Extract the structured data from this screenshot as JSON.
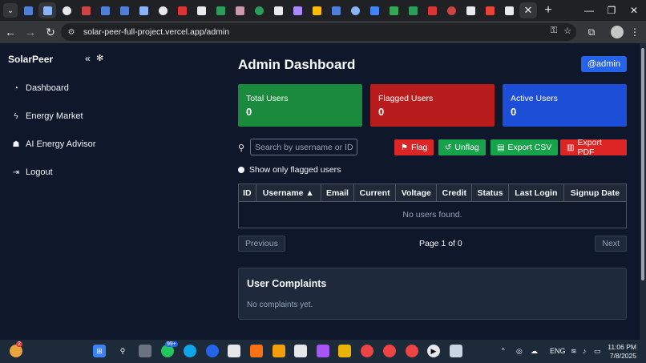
{
  "browser": {
    "url": "solar-peer-full-project.vercel.app/admin",
    "tab_favicon_colors": [
      "#4f7fd9",
      "#8ab4f8",
      "#e8eaed",
      "#c44",
      "#4f7fd9",
      "#4f7fd9",
      "#8ab4f8",
      "#e8eaed",
      "#d33",
      "#e8eaed",
      "#2a9d5a",
      "#c9a",
      "#2a9d5a",
      "#e8eaed",
      "#a8f",
      "#fbbc04",
      "#4f7fd9",
      "#8ab4f8",
      "#4285f4",
      "#34a853",
      "#2a9d5a",
      "#d33",
      "#c44",
      "#e8eaed",
      "#ea4335",
      "#e8eaed"
    ]
  },
  "sidebar": {
    "brand": "SolarPeer",
    "items": [
      {
        "label": "Dashboard",
        "icon": "gauge-icon"
      },
      {
        "label": "Energy Market",
        "icon": "bolt-icon"
      },
      {
        "label": "AI Energy Advisor",
        "icon": "robot-icon"
      },
      {
        "label": "Logout",
        "icon": "logout-icon"
      }
    ]
  },
  "header": {
    "title": "Admin Dashboard",
    "user_badge": "@admin"
  },
  "stats": [
    {
      "label": "Total Users",
      "value": "0",
      "color": "#1a8a3c"
    },
    {
      "label": "Flagged Users",
      "value": "0",
      "color": "#b91c1c"
    },
    {
      "label": "Active Users",
      "value": "0",
      "color": "#1d4ed8"
    }
  ],
  "search": {
    "placeholder": "Search by username or ID",
    "value": ""
  },
  "actions": {
    "flag": "Flag",
    "unflag": "Unflag",
    "export_csv": "Export CSV",
    "export_pdf": "Export PDF"
  },
  "filter": {
    "flagged_only_label": "Show only flagged users"
  },
  "table": {
    "columns": [
      "ID",
      "Username ▲",
      "Email",
      "Current",
      "Voltage",
      "Credit",
      "Status",
      "Last Login",
      "Signup Date"
    ],
    "empty_message": "No users found."
  },
  "pagination": {
    "previous": "Previous",
    "page_info": "Page 1 of 0",
    "next": "Next"
  },
  "complaints": {
    "title": "User Complaints",
    "empty_message": "No complaints yet."
  },
  "taskbar": {
    "weather_badge": "2",
    "whatsapp_badge": "99+",
    "language": "ENG",
    "time": "11:06 PM",
    "date": "7/8/2025"
  }
}
